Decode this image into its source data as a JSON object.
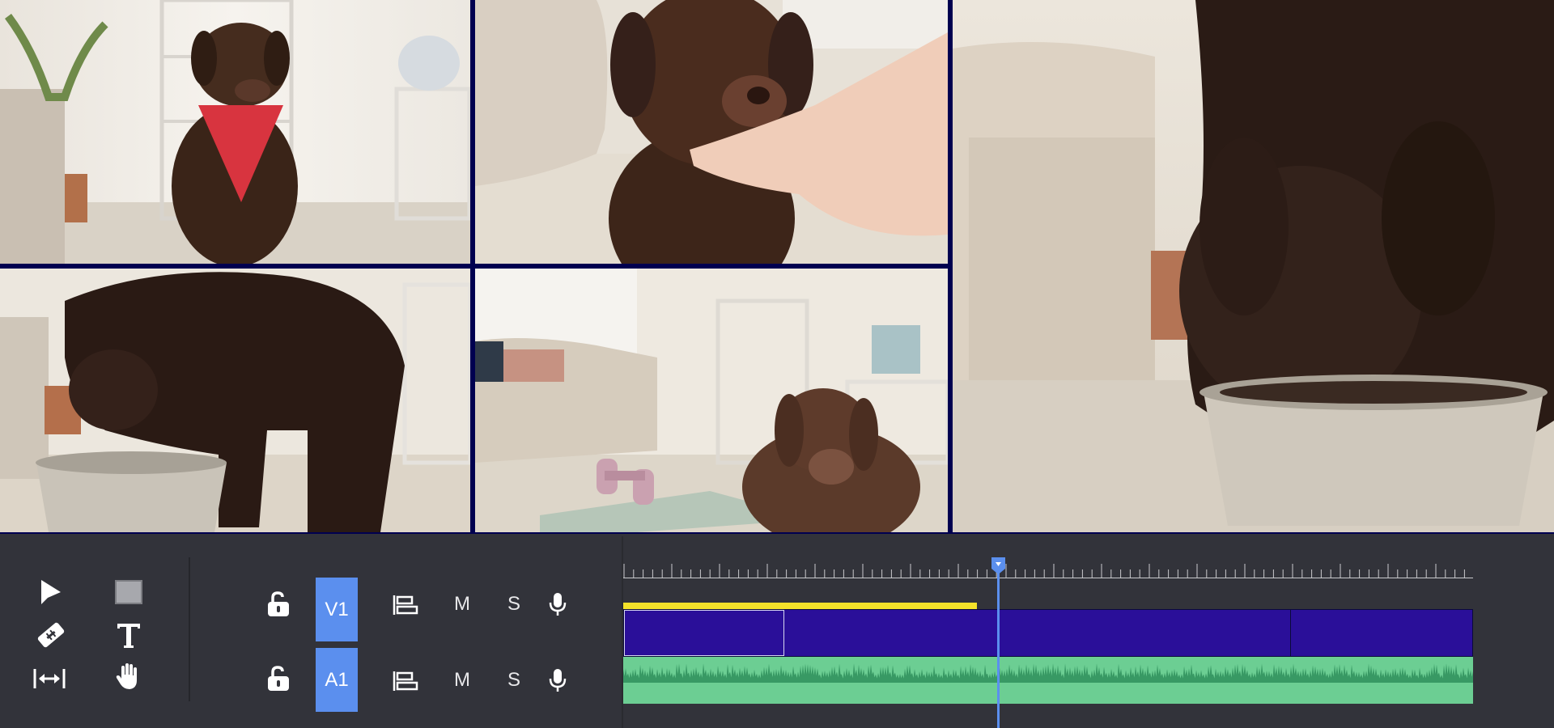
{
  "preview": {
    "clips": [
      {
        "subject": "dog-bandana"
      },
      {
        "subject": "dog-petted"
      },
      {
        "subject": "dog-eating-1"
      },
      {
        "subject": "dog-lying"
      },
      {
        "subject": "dog-eating-2"
      }
    ]
  },
  "tools": [
    {
      "name": "selection-tool",
      "icon": "arrow-pointer-icon"
    },
    {
      "name": "rectangle-tool",
      "icon": "square-icon"
    },
    {
      "name": "razor-tool",
      "icon": "razor-blade-icon"
    },
    {
      "name": "text-tool",
      "icon": "text-t-icon"
    },
    {
      "name": "ripple-tool",
      "icon": "horizontal-resize-icon"
    },
    {
      "name": "hand-tool",
      "icon": "hand-icon"
    }
  ],
  "tracks": [
    {
      "label": "V1",
      "mute_label": "M",
      "solo_label": "S",
      "lock_icon": "lock-open-icon",
      "sync_icon": "track-output-icon",
      "mic_icon": "microphone-icon"
    },
    {
      "label": "A1",
      "mute_label": "M",
      "solo_label": "S",
      "lock_icon": "lock-open-icon",
      "sync_icon": "track-output-icon",
      "mic_icon": "microphone-icon"
    }
  ],
  "timeline": {
    "work_area_end_fraction": 0.416,
    "playhead_fraction": 0.44,
    "video_clip_boundaries_fraction": [
      0.189,
      0.785
    ]
  },
  "colors": {
    "panel_bg": "#32333a",
    "accent_blue": "#5b8fee",
    "video_clip": "#2a0f99",
    "audio_clip": "#6cce93",
    "work_area": "#f4e22a"
  }
}
